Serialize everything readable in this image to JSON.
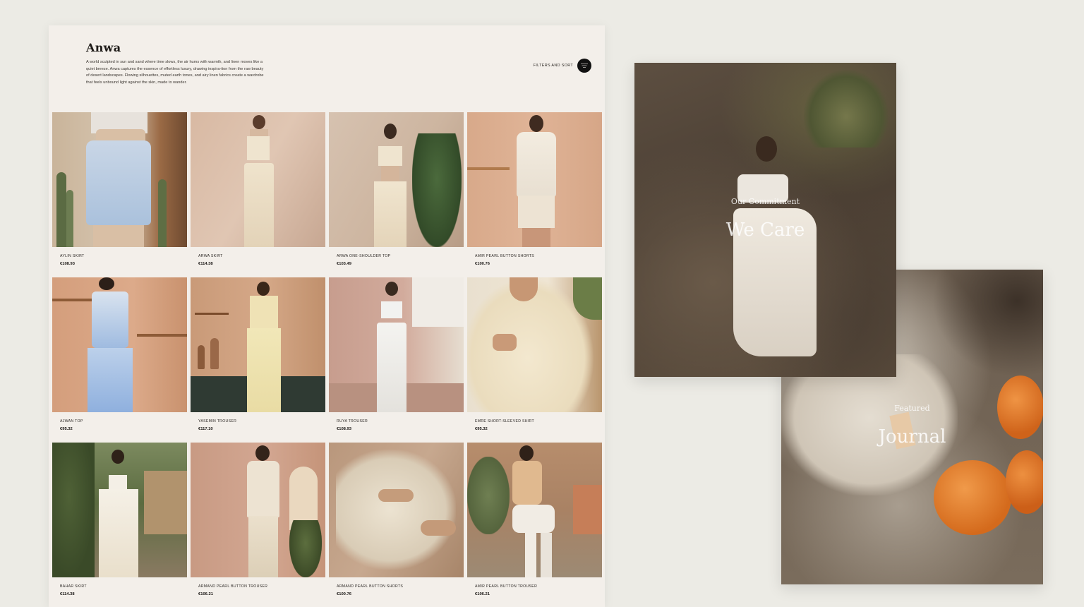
{
  "collection": {
    "title": "Anwa",
    "description": "A world sculpted in sun and sand where time slows, the air hums with warmth, and linen moves like a quiet breeze. Anwa captures the essence of effortless luxury, drawing inspira-tion from the raw beauty of desert landscapes. Flowing silhouettes, muted earth tones, and airy linen fabrics create a wardrobe that feels unbound light against the skin, made to wander."
  },
  "filters": {
    "label": "FILTERS AND SORT"
  },
  "products": [
    {
      "name": "AYLIN SKIRT",
      "price": "€108.93"
    },
    {
      "name": "ARWA SKIRT",
      "price": "€114.38"
    },
    {
      "name": "ARWA ONE-SHOULDER TOP",
      "price": "€103.49"
    },
    {
      "name": "AMIR PEARL BUTTON SHORTS",
      "price": "€100.76"
    },
    {
      "name": "AJWAN TOP",
      "price": "€95.32"
    },
    {
      "name": "YASEMIN TROUSER",
      "price": "€117.10"
    },
    {
      "name": "RUYA TROUSER",
      "price": "€108.93"
    },
    {
      "name": "EMRE SHORT-SLEEVED SHIRT",
      "price": "€95.32"
    },
    {
      "name": "BAHAR SKIRT",
      "price": "€114.38"
    },
    {
      "name": "ARMAND PEARL BUTTON TROUSER",
      "price": "€106.21"
    },
    {
      "name": "ARMAND PEARL BUTTON SHORTS",
      "price": "€100.76"
    },
    {
      "name": "AMIR PEARL BUTTON TROUSER",
      "price": "€106.21"
    }
  ],
  "editorial": {
    "commitment": {
      "eyebrow": "Our Commitment",
      "title": "We Care"
    },
    "journal": {
      "eyebrow": "Featured",
      "title": "Journal"
    }
  },
  "colors": {
    "page_background": "#ecebe5",
    "card_background": "#f3efea",
    "text_primary": "#1e1b18"
  }
}
